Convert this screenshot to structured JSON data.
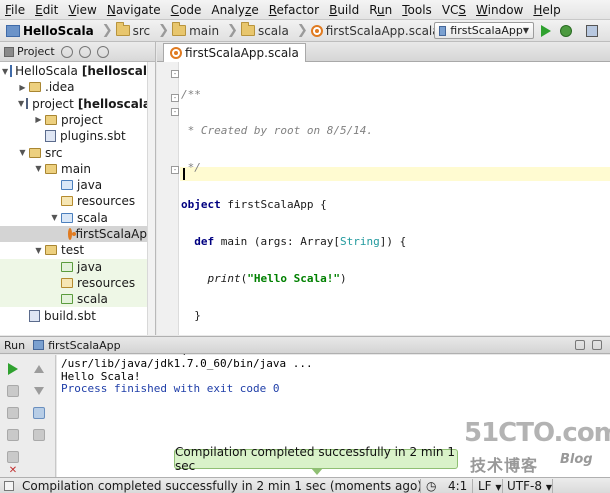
{
  "menu": [
    "File",
    "Edit",
    "View",
    "Navigate",
    "Code",
    "Analyze",
    "Refactor",
    "Build",
    "Run",
    "Tools",
    "VCS",
    "Window",
    "Help"
  ],
  "menu_mnemonics": [
    "F",
    "E",
    "V",
    "N",
    "C",
    "z",
    "R",
    "B",
    "u",
    "T",
    "S",
    "W",
    "H"
  ],
  "breadcrumb": {
    "project": "HelloScala",
    "items": [
      "src",
      "main",
      "scala",
      "firstScalaApp.scala"
    ]
  },
  "run_config": {
    "label": "firstScalaApp"
  },
  "project_panel": {
    "title": "Project",
    "tree": [
      {
        "depth": 0,
        "arrow": "open",
        "icon": "project",
        "label": "HelloScala",
        "suffix": "[helloscala]",
        "bold": true
      },
      {
        "depth": 1,
        "arrow": "closed",
        "icon": "folder",
        "label": ".idea"
      },
      {
        "depth": 1,
        "arrow": "open",
        "icon": "lib",
        "label": "project",
        "suffix": "[helloscala-b",
        "bold": true
      },
      {
        "depth": 2,
        "arrow": "closed",
        "icon": "folder",
        "label": "project"
      },
      {
        "depth": 2,
        "arrow": "none",
        "icon": "sbt",
        "label": "plugins.sbt"
      },
      {
        "depth": 1,
        "arrow": "open",
        "icon": "folder",
        "label": "src"
      },
      {
        "depth": 2,
        "arrow": "open",
        "icon": "folder",
        "label": "main"
      },
      {
        "depth": 3,
        "arrow": "none",
        "icon": "src",
        "label": "java"
      },
      {
        "depth": 3,
        "arrow": "none",
        "icon": "res",
        "label": "resources"
      },
      {
        "depth": 3,
        "arrow": "open",
        "icon": "src",
        "label": "scala"
      },
      {
        "depth": 4,
        "arrow": "none",
        "icon": "scala",
        "label": "firstScalaAp",
        "selected": true
      },
      {
        "depth": 2,
        "arrow": "open",
        "icon": "folder",
        "label": "test"
      },
      {
        "depth": 3,
        "arrow": "none",
        "icon": "testsrc",
        "label": "java",
        "test": true
      },
      {
        "depth": 3,
        "arrow": "none",
        "icon": "res",
        "label": "resources",
        "test": true
      },
      {
        "depth": 3,
        "arrow": "none",
        "icon": "testsrc",
        "label": "scala",
        "test": true
      },
      {
        "depth": 1,
        "arrow": "none",
        "icon": "sbt",
        "label": "build.sbt"
      }
    ]
  },
  "editor": {
    "tab": "firstScalaApp.scala",
    "code": {
      "comment_open": "/**",
      "comment_body": " * Created by root on 8/5/14.",
      "comment_close": " */",
      "kw_object": "object",
      "class_name": " firstScalaApp {",
      "kw_def": "def",
      "main_sig_a": " main (args: Array[",
      "type_string": "String",
      "main_sig_b": "]) {",
      "print_fn": "print",
      "print_open": "(",
      "print_str": "\"Hello Scala!\"",
      "print_close": ")",
      "close_inner": "}",
      "close_outer": "}"
    }
  },
  "run_panel": {
    "label": "Run",
    "config": "firstScalaApp",
    "console": [
      "/usr/lib/java/jdk1.7.0_60/bin/java ...",
      "Hello Scala!",
      "Process finished with exit code 0"
    ]
  },
  "balloon": "Compilation completed successfully in 2 min 1 sec",
  "statusbar": {
    "message": "Compilation completed successfully in 2 min 1 sec (moments ago)",
    "position": "4:1",
    "line_sep": "LF",
    "encoding": "UTF-8"
  },
  "watermark": {
    "main": "51CTO.com",
    "sub": "技术博客",
    "blog": "Blog"
  }
}
